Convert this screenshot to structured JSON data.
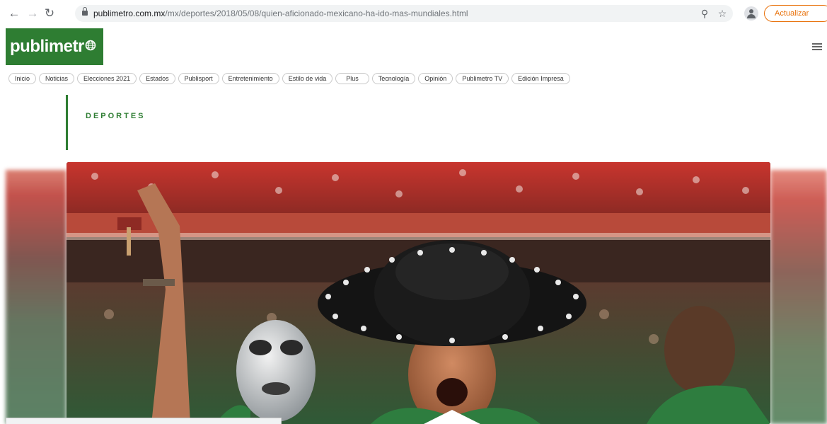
{
  "browser": {
    "back_icon": "arrow-left-icon",
    "forward_icon": "arrow-right-icon",
    "reload_icon": "reload-icon",
    "url_host": "publimetro.com.mx",
    "url_path": "/mx/deportes/2018/05/08/quien-aficionado-mexicano-ha-ido-mas-mundiales.html",
    "zoom_icon": "zoom-icon",
    "bookmark_icon": "star-icon",
    "profile_icon": "profile-icon",
    "update_label": "Actualizar"
  },
  "site": {
    "logo_text": "publimetr",
    "logo_icon": "globe-icon",
    "brand_color": "#2e7d32",
    "menu_icon": "hamburger-icon"
  },
  "menu": {
    "items": [
      {
        "label": "Inicio"
      },
      {
        "label": "Noticias"
      },
      {
        "label": "Elecciones 2021"
      },
      {
        "label": "Estados"
      },
      {
        "label": "Publisport"
      },
      {
        "label": "Entretenimiento"
      },
      {
        "label": "Estilo de vida"
      },
      {
        "label": "Plus"
      },
      {
        "label": "Tecnología"
      },
      {
        "label": "Opinión"
      },
      {
        "label": "Publimetro TV"
      },
      {
        "label": "Edición Impresa"
      }
    ]
  },
  "article": {
    "section": "DEPORTES"
  }
}
